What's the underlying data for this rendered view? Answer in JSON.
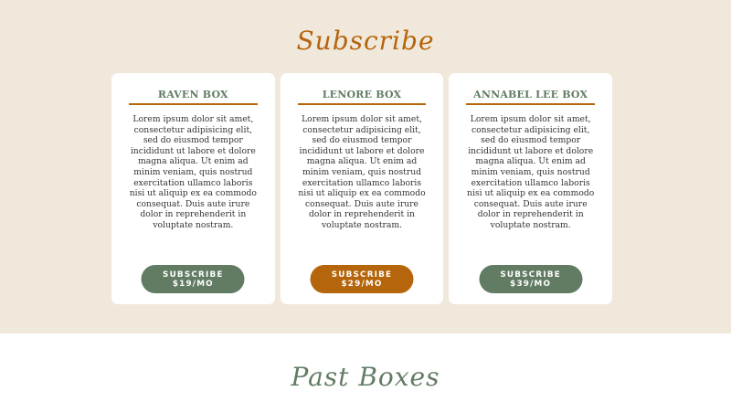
{
  "subscribe_section": {
    "title": "Subscribe",
    "cards": [
      {
        "title": "RAVEN BOX",
        "description": "Lorem ipsum dolor sit amet, consectetur adipisicing elit, sed do eiusmod tempor incididunt ut labore et dolore magna aliqua. Ut enim ad minim veniam, quis nostrud exercitation ullamco laboris nisi ut aliquip ex ea commodo consequat. Duis aute irure dolor in reprehenderit in voluptate nostram.",
        "button_line1": "SUBSCRIBE",
        "button_line2": "$19/MO"
      },
      {
        "title": "LENORE BOX",
        "description": "Lorem ipsum dolor sit amet, consectetur adipisicing elit, sed do eiusmod tempor incididunt ut labore et dolore magna aliqua. Ut enim ad minim veniam, quis nostrud exercitation ullamco laboris nisi ut aliquip ex ea commodo consequat. Duis aute irure dolor in reprehenderit in voluptate nostram.",
        "button_line1": "SUBSCRIBE",
        "button_line2": "$29/MO"
      },
      {
        "title": "ANNABEL LEE BOX",
        "description": "Lorem ipsum dolor sit amet, consectetur adipisicing elit, sed do eiusmod tempor incididunt ut labore et dolore magna aliqua. Ut enim ad minim veniam, quis nostrud exercitation ullamco laboris nisi ut aliquip ex ea commodo consequat. Duis aute irure dolor in reprehenderit in voluptate nostram.",
        "button_line1": "SUBSCRIBE",
        "button_line2": "$39/MO"
      }
    ]
  },
  "past_section": {
    "title": "Past Boxes"
  },
  "colors": {
    "section_background": "#f1e8dc",
    "accent_green": "#627c63",
    "accent_orange": "#b5650b"
  }
}
